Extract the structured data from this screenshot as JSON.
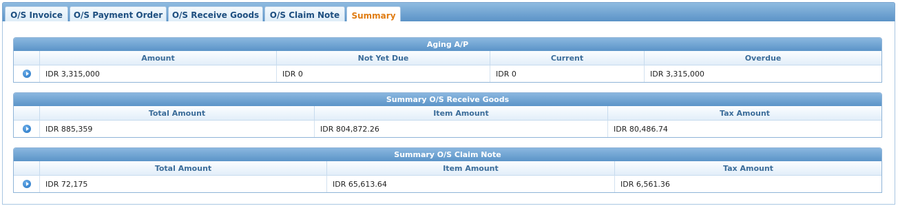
{
  "tabs": [
    {
      "label": "O/S Invoice"
    },
    {
      "label": "O/S Payment Order"
    },
    {
      "label": "O/S Receive Goods"
    },
    {
      "label": "O/S Claim Note"
    },
    {
      "label": "Summary",
      "active": true
    }
  ],
  "aging": {
    "title": "Aging A/P",
    "columns": [
      "Amount",
      "Not Yet Due",
      "Current",
      "Overdue"
    ],
    "row": [
      "IDR 3,315,000",
      "IDR 0",
      "IDR 0",
      "IDR 3,315,000"
    ]
  },
  "receive_goods": {
    "title": "Summary O/S Receive Goods",
    "columns": [
      "Total Amount",
      "Item Amount",
      "Tax Amount"
    ],
    "row": [
      "IDR 885,359",
      "IDR 804,872.26",
      "IDR 80,486.74"
    ]
  },
  "claim_note": {
    "title": "Summary O/S Claim Note",
    "columns": [
      "Total Amount",
      "Item Amount",
      "Tax Amount"
    ],
    "row": [
      "IDR 72,175",
      "IDR 65,613.64",
      "IDR 6,561.36"
    ]
  },
  "colors": {
    "header_blue": "#5b94c8",
    "tab_text": "#1e4f80",
    "active_tab_text": "#e07c12",
    "column_header_text": "#3b6c99"
  }
}
